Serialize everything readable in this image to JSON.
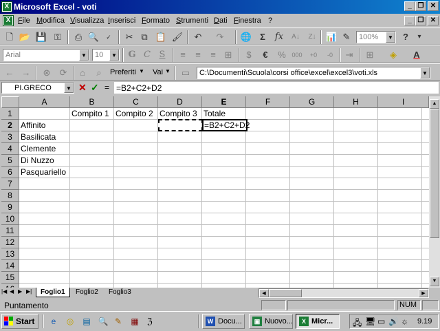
{
  "window": {
    "title": "Microsoft Excel - voti",
    "app_icon": "X"
  },
  "menu": {
    "items": [
      "File",
      "Modifica",
      "Visualizza",
      "Inserisci",
      "Formato",
      "Strumenti",
      "Dati",
      "Finestra",
      "?"
    ]
  },
  "standard_toolbar": {
    "zoom": "100%"
  },
  "format_toolbar": {
    "font": "Arial",
    "size": "10"
  },
  "web_toolbar": {
    "favorites_label": "Preferiti",
    "goto_label": "Vai",
    "address": "C:\\Documenti\\Scuola\\corsi office\\excel\\excel3\\voti.xls"
  },
  "formula_bar": {
    "name_box": "PI.GRECO",
    "cancel_symbol": "✕",
    "enter_symbol": "✓",
    "equals_symbol": "=",
    "formula": "=B2+C2+D2"
  },
  "sheet": {
    "columns": [
      "A",
      "B",
      "C",
      "D",
      "E",
      "F",
      "G",
      "H",
      "I"
    ],
    "rows": [
      "1",
      "2",
      "3",
      "4",
      "5",
      "6",
      "7",
      "8",
      "9",
      "10",
      "11",
      "12",
      "13",
      "14",
      "15",
      "16"
    ],
    "headers": {
      "b1": "Compito 1",
      "c1": "Compito 2",
      "d1": "Compito 3",
      "e1": "Totale"
    },
    "names": [
      "Affinito",
      "Basilicata",
      "Clemente",
      "Di Nuzzo",
      "Pasquariello"
    ],
    "active_cell_text": "=B2+C2+D2"
  },
  "sheet_tabs": [
    "Foglio1",
    "Foglio2",
    "Foglio3"
  ],
  "status": {
    "mode": "Puntamento",
    "num": "NUM"
  },
  "taskbar": {
    "start_label": "Start",
    "tasks": [
      "Docu...",
      "Nuovo...",
      "Micr..."
    ],
    "clock": "9.19"
  }
}
